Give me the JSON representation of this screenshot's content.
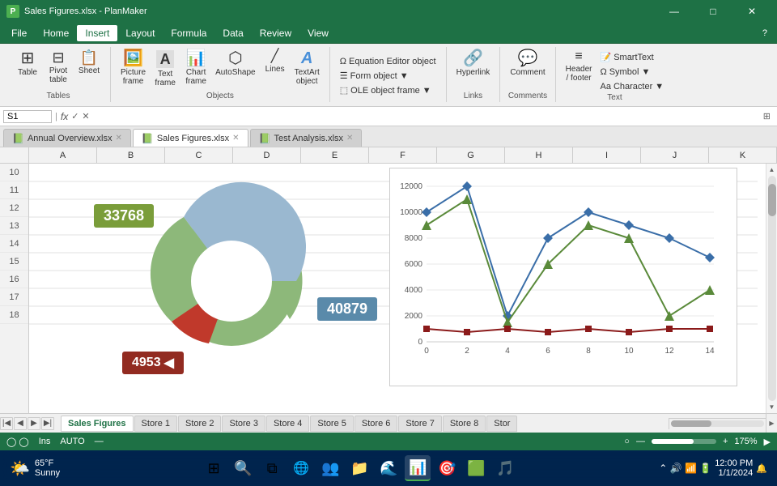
{
  "titleBar": {
    "appIcon": "P",
    "title": "Sales Figures.xlsx - PlanMaker",
    "minimize": "—",
    "maximize": "□",
    "close": "✕"
  },
  "menuBar": {
    "items": [
      "File",
      "Home",
      "Insert",
      "Layout",
      "Formula",
      "Data",
      "Review",
      "View"
    ]
  },
  "ribbon": {
    "groups": [
      {
        "label": "Tables",
        "buttons": [
          {
            "icon": "⊞",
            "label": "Table"
          },
          {
            "icon": "⊟",
            "label": "Pivot table"
          },
          {
            "icon": "⊡",
            "label": "Sheet"
          }
        ]
      },
      {
        "label": "Objects",
        "buttons": [
          {
            "icon": "🖼",
            "label": "Picture frame"
          },
          {
            "icon": "A",
            "label": "Text frame"
          },
          {
            "icon": "📊",
            "label": "Chart frame"
          },
          {
            "icon": "⬡",
            "label": "AutoShape"
          },
          {
            "icon": "—",
            "label": "Lines"
          },
          {
            "icon": "A",
            "label": "TextArt object"
          }
        ]
      },
      {
        "label": "",
        "smallButtons": [
          "Equation Editor object",
          "Form object ▼",
          "OLE object frame ▼"
        ]
      },
      {
        "label": "Links",
        "buttons": [
          {
            "icon": "🔗",
            "label": "Hyperlink"
          }
        ]
      },
      {
        "label": "Comments",
        "buttons": [
          {
            "icon": "💬",
            "label": "Comment"
          }
        ]
      },
      {
        "label": "Text",
        "buttons": [
          {
            "icon": "≡",
            "label": "Header / footer"
          }
        ],
        "smallButtons": [
          "SmartText",
          "Symbol ▼",
          "Character ▼"
        ]
      }
    ]
  },
  "formulaBar": {
    "cellRef": "S1",
    "formula": ""
  },
  "tabs": [
    {
      "label": "Annual Overview.xlsx",
      "active": false
    },
    {
      "label": "Sales Figures.xlsx",
      "active": true
    },
    {
      "label": "Test Analysis.xlsx",
      "active": false
    }
  ],
  "columns": [
    "A",
    "B",
    "C",
    "D",
    "E",
    "F",
    "G",
    "H",
    "I",
    "J",
    "K"
  ],
  "rows": [
    "10",
    "11",
    "12",
    "13",
    "14",
    "15",
    "16",
    "17",
    "18"
  ],
  "donutChart": {
    "value1": "33768",
    "value2": "40879",
    "value3": "4953"
  },
  "lineChart": {
    "yLabels": [
      "12000",
      "10000",
      "8000",
      "6000",
      "4000",
      "2000",
      "0"
    ],
    "xLabels": [
      "0",
      "2",
      "4",
      "6",
      "8",
      "10",
      "12",
      "14"
    ]
  },
  "sheetTabs": [
    {
      "label": "Sales Figures",
      "active": true
    },
    {
      "label": "Store 1"
    },
    {
      "label": "Store 2"
    },
    {
      "label": "Store 3"
    },
    {
      "label": "Store 4"
    },
    {
      "label": "Store 5"
    },
    {
      "label": "Store 6"
    },
    {
      "label": "Store 7"
    },
    {
      "label": "Store 8"
    },
    {
      "label": "Stor"
    }
  ],
  "statusBar": {
    "left": [
      "Ins",
      "AUTO"
    ],
    "zoom": "175%"
  },
  "taskbar": {
    "weather": "65°F",
    "condition": "Sunny"
  }
}
